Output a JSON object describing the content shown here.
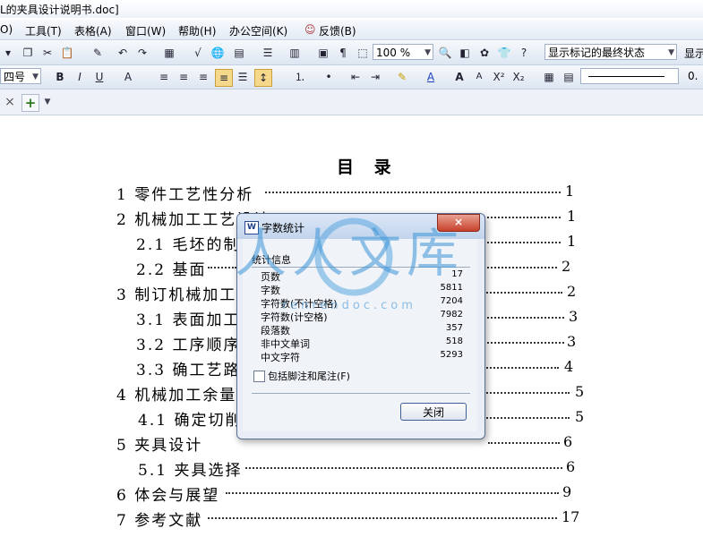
{
  "window": {
    "title": "L的夹具设计说明书.doc]"
  },
  "menu": {
    "items": [
      "O)",
      "工具(T)",
      "表格(A)",
      "窗口(W)",
      "帮助(H)",
      "办公空间(K)",
      "反馈(B)"
    ]
  },
  "toolbar": {
    "zoom_value": "100 %",
    "track_changes_value": "显示标记的最终状态",
    "right_label": "显示",
    "font_size_value": "四号",
    "line_width_value": "0."
  },
  "tabs": {
    "close_label": "×",
    "add_label": "+"
  },
  "document": {
    "toc_title": "目 录",
    "entries": [
      {
        "text": "1 零件工艺性分析",
        "page": "1"
      },
      {
        "text": "2 机械加工工艺设计",
        "page": "1"
      },
      {
        "text": "2.1 毛坯的制",
        "page": "1"
      },
      {
        "text": "2.2 基面",
        "page": "2"
      },
      {
        "text": "3 制订机械加工",
        "page": "2"
      },
      {
        "text": "3.1 表面加工",
        "page": "3"
      },
      {
        "text": "3.2 工序顺序",
        "page": "3"
      },
      {
        "text": "3.3 确工艺路",
        "page": "4"
      },
      {
        "text": "4 机械加工余量",
        "page": "5"
      },
      {
        "text": "4.1 确定切削",
        "page": "5"
      },
      {
        "text": "5 夹具设计",
        "page": "6"
      },
      {
        "text": "5.1 夹具选择",
        "page": "6"
      },
      {
        "text": "6 体会与展望",
        "page": "9"
      },
      {
        "text": "7 参考文献",
        "page": "17"
      }
    ]
  },
  "watermark": {
    "text": "人人文库",
    "url_text": "renrendoc.com"
  },
  "dialog": {
    "title": "字数统计",
    "close_x": "×",
    "group_label": "统计信息",
    "stats": [
      {
        "label": "页数",
        "value": "17"
      },
      {
        "label": "字数",
        "value": "5811"
      },
      {
        "label": "字符数(不计空格)",
        "value": "7204"
      },
      {
        "label": "字符数(计空格)",
        "value": "7982"
      },
      {
        "label": "段落数",
        "value": "357"
      },
      {
        "label": "非中文单词",
        "value": "518"
      },
      {
        "label": "中文字符",
        "value": "5293"
      }
    ],
    "checkbox_label": "包括脚注和尾注(F)",
    "close_button": "关闭"
  }
}
